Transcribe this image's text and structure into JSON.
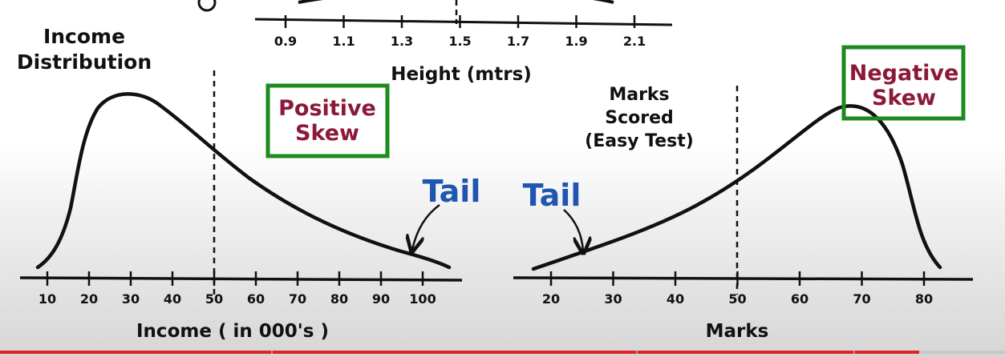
{
  "colors": {
    "ink": "#111111",
    "skew_box": "#1d8a1d",
    "skew_text": "#8b1a3a",
    "tail_text": "#1f56b0",
    "progress": "#e4211f"
  },
  "height_axis": {
    "ticks": [
      "0.9",
      "1.1",
      "1.3",
      "1.5",
      "1.7",
      "1.9",
      "2.1"
    ],
    "title": "Height (mtrs)"
  },
  "income": {
    "title_line1": "Income",
    "title_line2": "Distribution",
    "ticks": [
      "10",
      "20",
      "30",
      "40",
      "50",
      "60",
      "70",
      "80",
      "90",
      "100"
    ],
    "axis_title": "Income ( in 000's )",
    "skew_line1": "Positive",
    "skew_line2": "Skew",
    "tail": "Tail",
    "dashed_at": 50
  },
  "marks": {
    "note_line1": "Marks",
    "note_line2": "Scored",
    "note_line3": "(Easy Test)",
    "ticks": [
      "20",
      "30",
      "40",
      "50",
      "60",
      "70",
      "80"
    ],
    "axis_title": "Marks",
    "skew_line1": "Negative",
    "skew_line2": "Skew",
    "tail": "Tail",
    "dashed_at": 50
  },
  "video_progress": {
    "played_fraction": 0.915
  }
}
